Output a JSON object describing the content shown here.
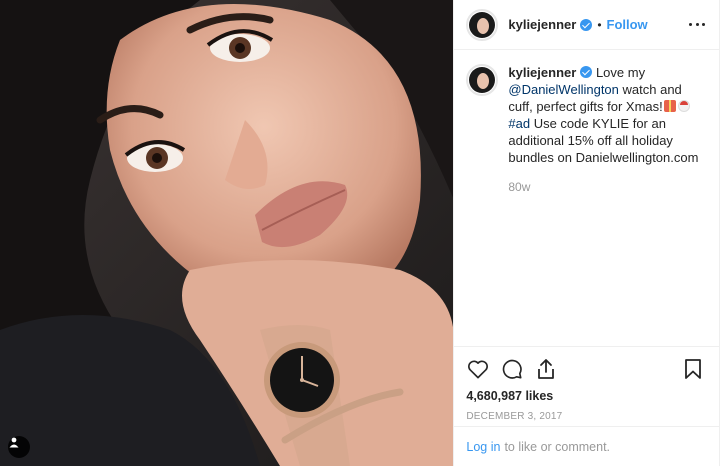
{
  "post": {
    "username": "kyliejenner",
    "follow_label": "Follow",
    "separator": "•",
    "caption": {
      "username": "kyliejenner",
      "part1": "Love my",
      "mention": "@DanielWellington",
      "part2": "watch and cuff, perfect gifts for Xmas!",
      "hashtag": "#ad",
      "part3": "Use code KYLIE for an additional 15% off all holiday bundles on Danielwellington.com"
    },
    "time_ago": "80w",
    "likes": "4,680,987 likes",
    "date": "DECEMBER 3, 2017",
    "login_link": "Log in",
    "login_suffix": "to like or comment."
  },
  "icons": {
    "like": "heart-icon",
    "comment": "comment-icon",
    "share": "share-icon",
    "save": "bookmark-icon",
    "tag": "user-tag-icon",
    "more": "more-options-icon",
    "verified": "verified-badge-icon"
  },
  "colors": {
    "accent": "#3897f0",
    "link": "#003569",
    "muted": "#999999",
    "text": "#262626"
  }
}
